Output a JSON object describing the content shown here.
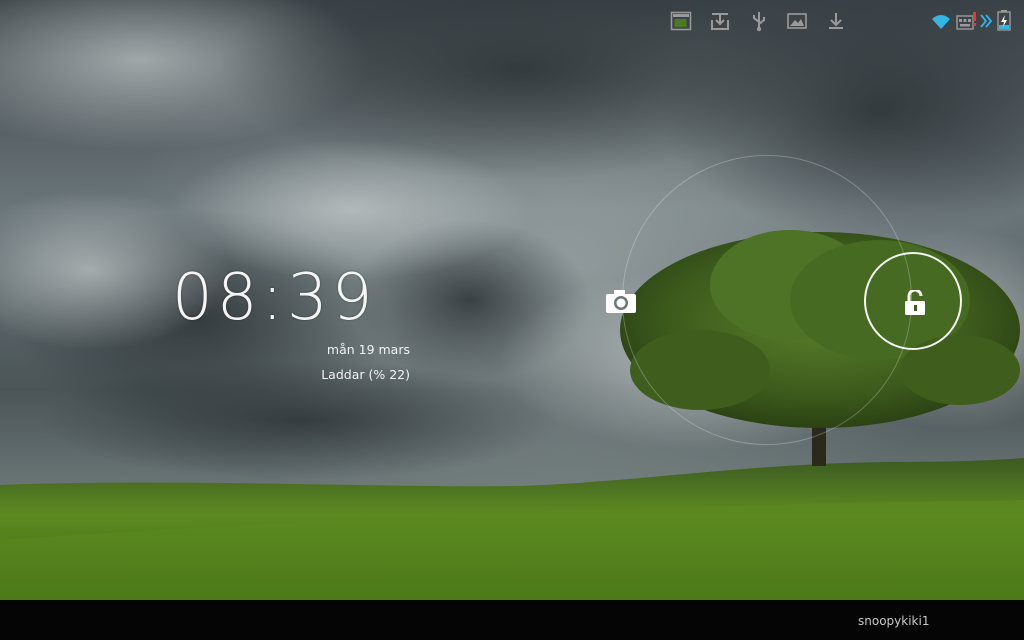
{
  "lockscreen": {
    "clock": "08:39",
    "date": "mån 19 mars",
    "charging_status": "Laddar (% 22)"
  },
  "targets": {
    "camera_icon": "camera-icon",
    "unlock_icon": "unlock-icon"
  },
  "statusbar": {
    "username": "snoopykiki1",
    "icons": [
      "screenshot-icon",
      "download-tray-icon",
      "usb-icon",
      "gallery-icon",
      "download-icon",
      "wifi-icon",
      "keyboard-alert-icon",
      "chevron-icon",
      "battery-charging-icon"
    ]
  },
  "colors": {
    "sky": "#4f5b62",
    "grass": "#5f8a22",
    "accent": "#33b5e5"
  }
}
